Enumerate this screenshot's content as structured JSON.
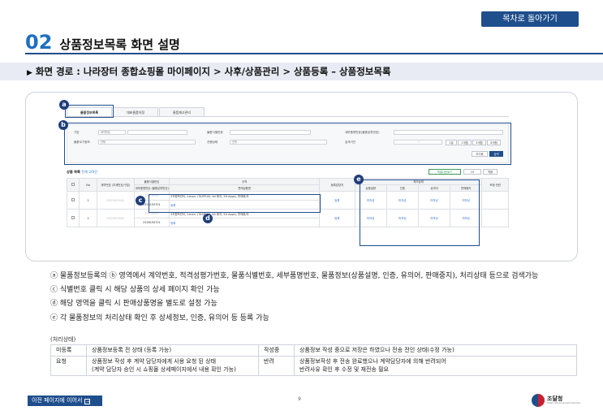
{
  "header": {
    "toc_button": "목차로 돌아가기",
    "section_number": "02",
    "title": "상품정보목록 화면 설명"
  },
  "path": {
    "label": "화면 경로 :",
    "value": "나라장터 종합쇼핑몰 마이페이지 > 사후/상품관리 > 상품등록 – 상품정보목록"
  },
  "screenshot": {
    "tabs": [
      "물품정보목록",
      "대표물품자정",
      "물품재고관리"
    ],
    "search": {
      "row1": {
        "label1": "구분",
        "select1": "계약번호",
        "label2": "물품식별번호",
        "label3": "세부품명번호(물품분류번호)"
      },
      "row2": {
        "label1": "물품무가정보",
        "select1": "전체",
        "label2": "진행상태",
        "select2": "전체",
        "label3": "검색기간",
        "range_sep": "~"
      },
      "period_buttons": [
        "1일",
        "1개월",
        "3개월",
        "6개월"
      ],
      "reset_button": "초기화",
      "search_button": "검색"
    },
    "list": {
      "title": "상품 목록",
      "count": "전체 2/0건",
      "excel_button": "엑셀다운로드",
      "page_size": "15",
      "sort_button": "적용"
    },
    "table": {
      "headers": {
        "no": "No",
        "contract": "계약번호 (차계번호/구분)",
        "identification": "물품식별번호",
        "detail_no": "세부품명번호 (물품분류번호)",
        "spec": "규격",
        "product_name": "판매상품명",
        "registrant": "등록담당자",
        "status_group": "처리상태",
        "status_cols": [
          "상품설명",
          "인증",
          "유의어",
          "판매중지"
        ],
        "adjust": "조정 관련"
      },
      "rows": [
        {
          "no": "1",
          "contract": "0021000000",
          "identification": "23470000",
          "detail_no": "2326150701",
          "spec": "3차원프린터, Canon, (TA3P100, A4 용지, 2D Apps), 판매용/무",
          "product_name": "등록",
          "registrant": "등록",
          "status": [
            "미작성",
            "미작성",
            "미작성",
            "미작성"
          ]
        },
        {
          "no": "2",
          "contract": "0021000000",
          "identification": "23470000",
          "detail_no": "2326150701",
          "spec": "3차원프린터, Canon, (TA3P100, A4 용지, 2D Apps), 판매용/무",
          "product_name": "등록",
          "registrant": "등록",
          "status": [
            "미작성",
            "미작성",
            "미작성",
            "미작성"
          ]
        }
      ]
    },
    "markers": [
      "a",
      "b",
      "c",
      "d",
      "e"
    ]
  },
  "descriptions": [
    "ⓐ 물품정보등록의 ⓑ 영역에서 계약번호, 적격성평가번호, 물품식별번호, 세부품명번호, 물품정보(상품설명, 인증, 유의어, 판매중지), 처리상태 등으로 검색가능",
    "ⓒ 식별번호 클릭 시 해당 상품의 상세 페이지 확인 가능",
    "ⓓ 해당 영역을 클릭 시 판매상품명을 별도로 설정 가능",
    "ⓔ 각 물품정보의 처리상태 확인 후 상세정보, 인증, 유의어 등 등록 가능"
  ],
  "status_table": {
    "label": "(처리상태)",
    "rows": [
      {
        "k1": "미등록",
        "v1": "상품정보등록 전 상태 (등록 가능)",
        "k2": "작성중",
        "v2": "상품정보 작성 중으로 저장은 하였으나 전송 전인 상태(수정 가능)"
      },
      {
        "k1": "요청",
        "v1": "상품정보 작성 후 계약 담당자에게 사용 요청 된 상태\n(계약 담당자 승인 시 쇼핑몰 상세페이지에서 내용 확인 가능)",
        "k2": "반려",
        "v2": "상품정보작성 후 전송 완료했으나 계약담당자에 의해 반려되어\n반려사유 확인 후 수정 및 재전송 필요"
      }
    ]
  },
  "footer": {
    "prev_button": "이전 페이지에 이어서",
    "page_number": "9",
    "logo_text": "조달청",
    "logo_sub": "Public Procurement Service"
  },
  "colors": {
    "primary": "#1f4e8c",
    "accent_number": "#1f6fbf",
    "path_bg": "#e8ebf4",
    "link": "#2d6fd0"
  }
}
